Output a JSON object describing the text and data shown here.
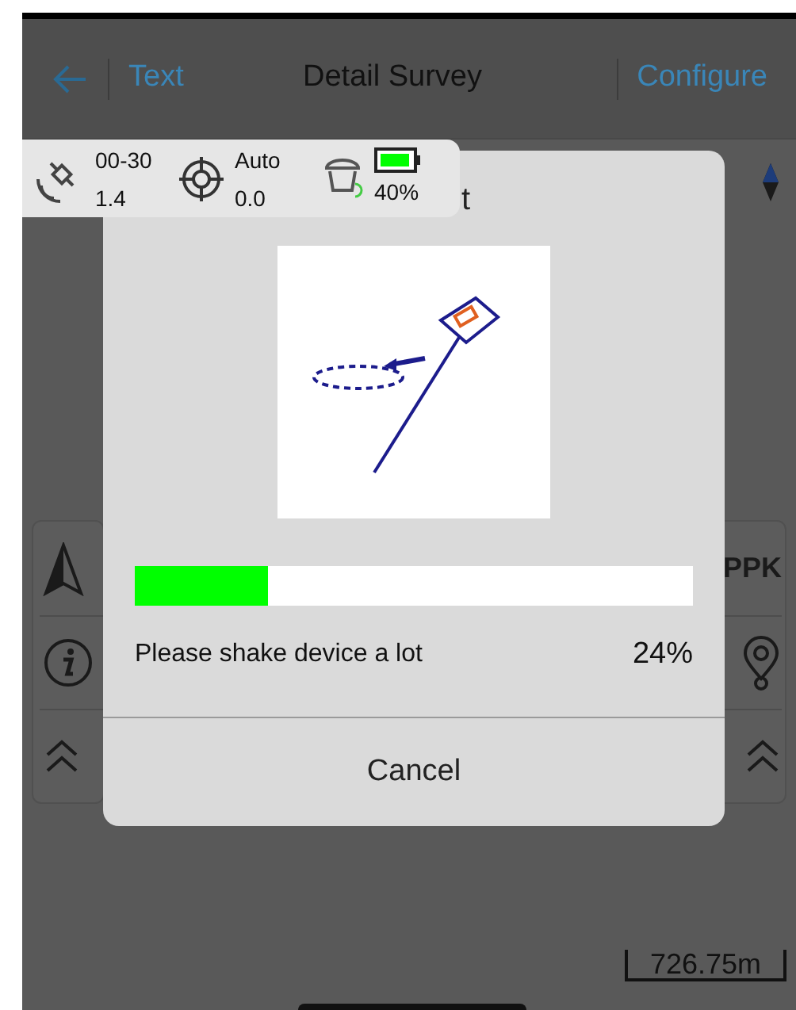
{
  "header": {
    "left_link": "Text",
    "title": "Detail Survey",
    "right_link": "Configure"
  },
  "status_bar": {
    "satellites": "00-30",
    "pdop": "1.4",
    "mode": "Auto",
    "age": "0.0",
    "battery": "40%"
  },
  "left_tools": [
    {
      "kind": "north"
    },
    {
      "kind": "info"
    },
    {
      "kind": "expand"
    }
  ],
  "right_tools": [
    {
      "kind": "text",
      "label": "PPK"
    },
    {
      "kind": "pin"
    },
    {
      "kind": "expand"
    }
  ],
  "scale": "726.75m",
  "dialog": {
    "title": "t",
    "progress": {
      "level": 0.24
    },
    "message": "Please shake device a lot",
    "percent": "24%",
    "button": "Cancel"
  }
}
